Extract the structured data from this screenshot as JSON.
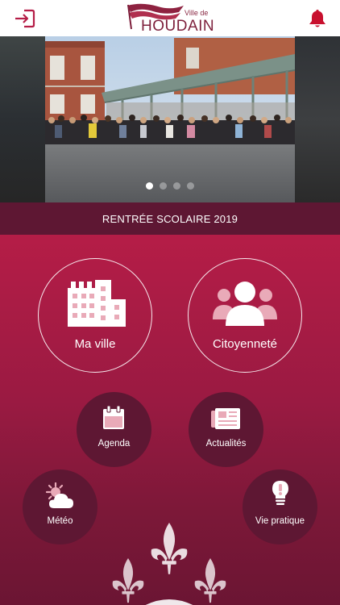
{
  "header": {
    "logo_prefix": "Ville de",
    "logo_name": "HOUDAIN",
    "login_icon": "login-icon",
    "notification_icon": "bell-icon"
  },
  "carousel": {
    "slide_caption": "RENTRÉE SCOLAIRE 2019",
    "slide_count": 4,
    "active_slide": 1
  },
  "tiles": {
    "ma_ville": {
      "label": "Ma ville",
      "icon": "buildings-icon"
    },
    "citoyennete": {
      "label": "Citoyenneté",
      "icon": "people-icon"
    },
    "agenda": {
      "label": "Agenda",
      "icon": "calendar-icon"
    },
    "actualites": {
      "label": "Actualités",
      "icon": "newspaper-icon"
    },
    "meteo": {
      "label": "Météo",
      "icon": "sun-cloud-icon"
    },
    "vie_pratique": {
      "label": "Vie pratique",
      "icon": "bulb-icon"
    }
  },
  "colors": {
    "accent": "#b51d47",
    "dark_accent": "#5e1733",
    "notification": "#c8102e",
    "icon_pink": "#e9aab8"
  }
}
